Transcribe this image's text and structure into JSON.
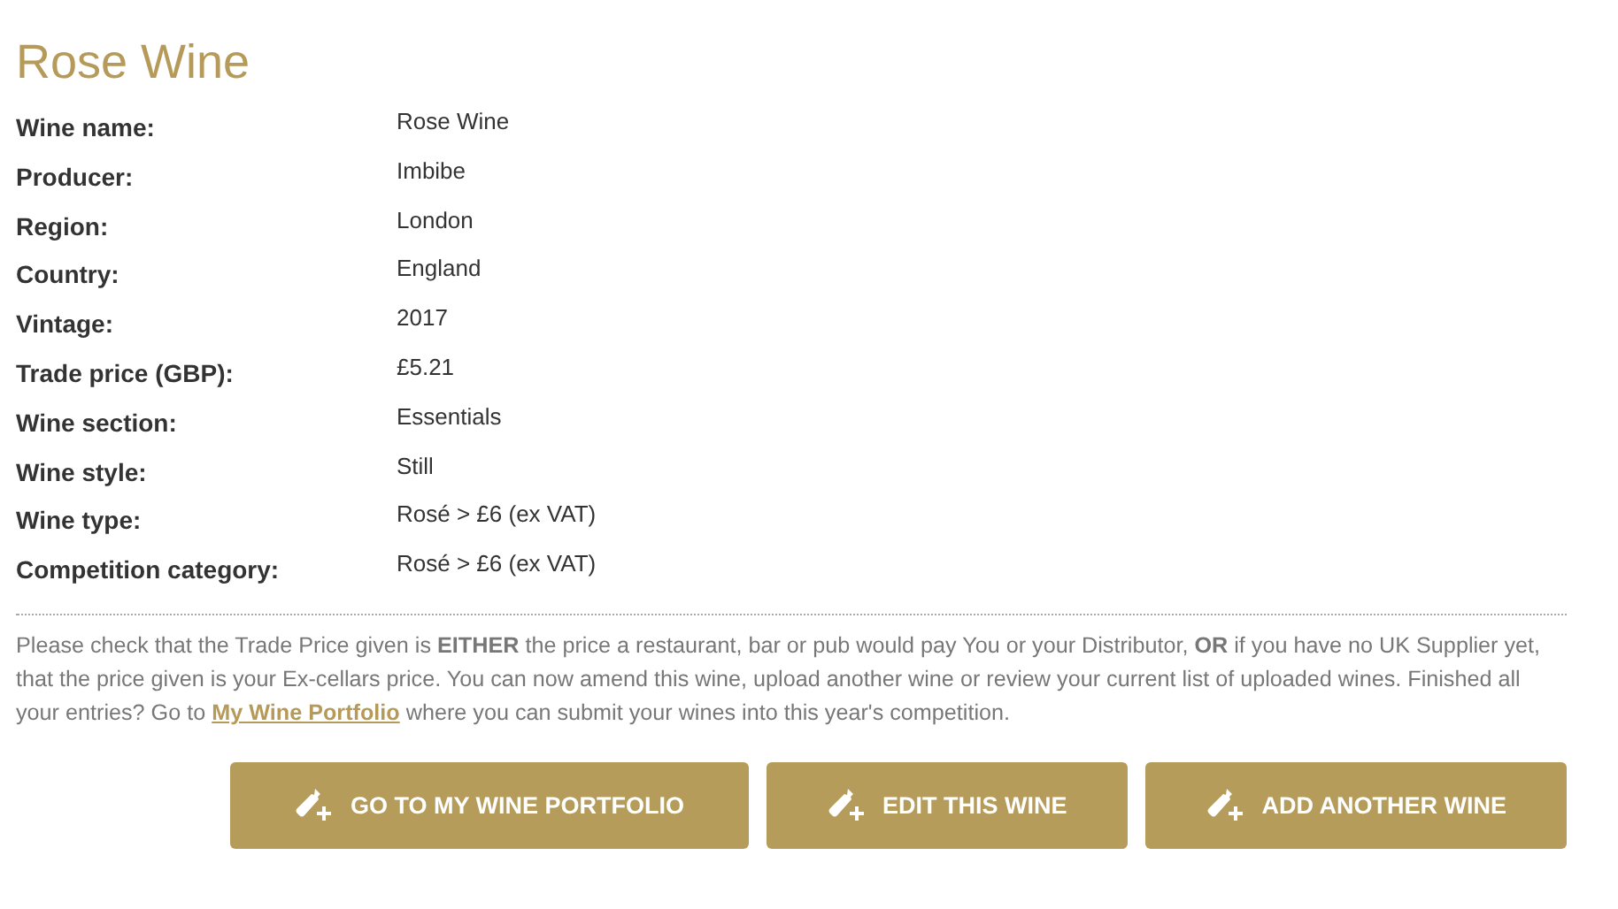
{
  "title": "Rose Wine",
  "details": [
    {
      "label": "Wine name:",
      "value": "Rose Wine"
    },
    {
      "label": "Producer:",
      "value": "Imbibe"
    },
    {
      "label": "Region:",
      "value": "London"
    },
    {
      "label": "Country:",
      "value": "England"
    },
    {
      "label": "Vintage:",
      "value": "2017"
    },
    {
      "label": "Trade price (GBP):",
      "value": "£5.21"
    },
    {
      "label": "Wine section:",
      "value": "Essentials"
    },
    {
      "label": "Wine style:",
      "value": "Still"
    },
    {
      "label": "Wine type:",
      "value": "Rosé > £6 (ex VAT)"
    },
    {
      "label": "Competition category:",
      "value": "Rosé > £6 (ex VAT)"
    }
  ],
  "notice": {
    "text": "Please check that the Trade Price given is **EITHER** the price a restaurant, bar or pub would pay You or your Distributor, **OR** if you have no UK Supplier yet, that the price given is your Ex-cellars price. You can now amend this wine, upload another wine or review your current list of uploaded wines. Finished all your entries? Go to",
    "link": "My Wine Portfolio",
    "text_after": "where you can submit your wines into this year's competition."
  },
  "buttons": [
    "GO TO MY WINE PORTFOLIO",
    "EDIT THIS WINE",
    "ADD ANOTHER WINE"
  ]
}
